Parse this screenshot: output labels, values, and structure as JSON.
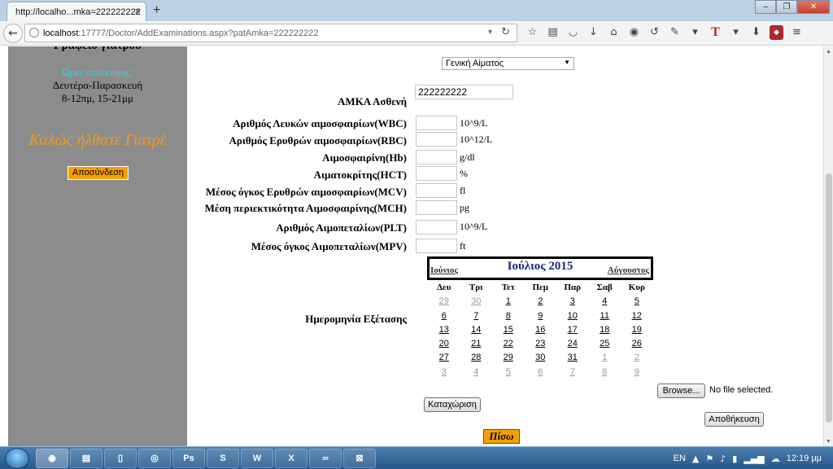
{
  "browser": {
    "tab_title": "http://localho...mka=222222222",
    "tab_close": "×",
    "new_tab": "+",
    "url_host": "localhost",
    "url_rest": ":17777/Doctor/AddExaminations.aspx?patAmka=222222222",
    "window_controls": [
      "‒",
      "❐",
      "✕"
    ]
  },
  "sidebar": {
    "title": "Γραφείο γιατρού",
    "hours_label": "Ώρες επίσκεψης:",
    "days": "Δευτέρα-Παρασκευή",
    "times": "8-12πμ, 15-21μμ",
    "welcome": "Καλώς ήλθατε Γιατρέ",
    "logout": "Αποσύνδεση"
  },
  "form": {
    "exam_type": "Γενική Αίματος",
    "amka_label": "ΑΜΚΑ Ασθενή",
    "amka_value": "222222222",
    "fields": [
      {
        "label": "Αριθμός Λευκών αιμοσφαιρίων(WBC)",
        "unit": "10^9/L"
      },
      {
        "label": "Αριθμός Ερυθρών αιμοσφαιρίων(RBC)",
        "unit": "10^12/L"
      },
      {
        "label": "Αιμοσφαιρίνη(Hb)",
        "unit": "g/dl"
      },
      {
        "label": "Αιματοκρίτης(HCT)",
        "unit": "%"
      },
      {
        "label": "Μέσος όγκος Ερυθρών αιμοσφαιρίων(MCV)",
        "unit": "fl"
      },
      {
        "label": "Μέση περιεκτικότητα Αιμοσφαιρίνης(MCH)",
        "unit": "pg"
      },
      {
        "label": "Αριθμός Αιμοπεταλίων(PLT)",
        "unit": "10^9/L"
      },
      {
        "label": "Μέσος όγκος Αιμοπεταλίων(MPV)",
        "unit": "ft"
      }
    ],
    "date_label": "Ημερομηνία Εξέτασης",
    "browse": "Browse...",
    "file_status": "No file selected.",
    "register": "Καταχώριση",
    "save": "Αποθήκευση",
    "back": "Πίσω"
  },
  "calendar": {
    "prev": "Ιούνιος",
    "title": "Ιούλιος 2015",
    "next": "Αύγουστος",
    "weekdays": [
      "Δευ",
      "Τρι",
      "Τετ",
      "Πεμ",
      "Παρ",
      "Σαβ",
      "Κυρ"
    ],
    "weeks": [
      [
        "29",
        "30",
        "1",
        "2",
        "3",
        "4",
        "5"
      ],
      [
        "6",
        "7",
        "8",
        "9",
        "10",
        "11",
        "12"
      ],
      [
        "13",
        "14",
        "15",
        "16",
        "17",
        "18",
        "19"
      ],
      [
        "20",
        "21",
        "22",
        "23",
        "24",
        "25",
        "26"
      ],
      [
        "27",
        "28",
        "29",
        "30",
        "31",
        "1",
        "2"
      ],
      [
        "3",
        "4",
        "5",
        "6",
        "7",
        "8",
        "9"
      ]
    ],
    "other_month": [
      [
        true,
        true,
        false,
        false,
        false,
        false,
        false
      ],
      [
        false,
        false,
        false,
        false,
        false,
        false,
        false
      ],
      [
        false,
        false,
        false,
        false,
        false,
        false,
        false
      ],
      [
        false,
        false,
        false,
        false,
        false,
        false,
        false
      ],
      [
        false,
        false,
        false,
        false,
        false,
        true,
        true
      ],
      [
        true,
        true,
        true,
        true,
        true,
        true,
        true
      ]
    ]
  },
  "taskbar": {
    "apps": [
      "firefox",
      "explorer",
      "notepad",
      "chrome",
      "Ps",
      "skype",
      "W",
      "X",
      "VS",
      "xampp"
    ],
    "app_glyphs": [
      "◉",
      "▤",
      "▯",
      "◎",
      "Ps",
      "S",
      "W",
      "X",
      "∞",
      "⊠"
    ],
    "language": "EN",
    "time": "12:19 μμ"
  },
  "colors": {
    "sidebar_bg": "#8c8c8c",
    "hours_label": "#29d8e8",
    "welcome": "#f39a1d",
    "accent_button": "#f5a000",
    "calendar_title": "#1a2a78"
  }
}
